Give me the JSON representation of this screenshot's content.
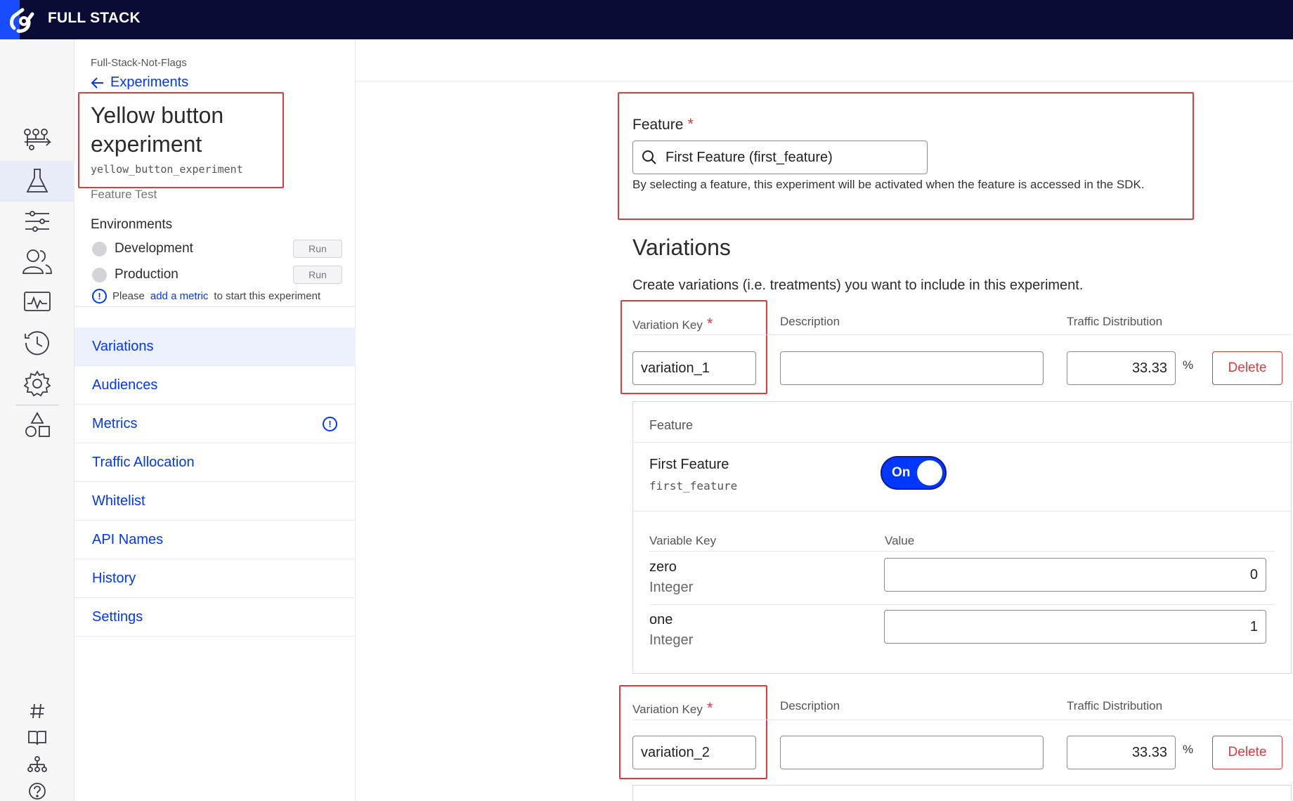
{
  "app": {
    "brand": "FULL STACK"
  },
  "breadcrumb": {
    "project": "Full-Stack-Not-Flags",
    "back_label": "Experiments"
  },
  "experiment": {
    "title": "Yellow button experiment",
    "key": "yellow_button_experiment",
    "type": "Feature Test"
  },
  "environments": {
    "heading": "Environments",
    "items": [
      {
        "name": "Development",
        "action": "Run"
      },
      {
        "name": "Production",
        "action": "Run"
      }
    ],
    "note_prefix": "Please",
    "note_link": "add a metric",
    "note_suffix": "to start this experiment"
  },
  "nav": {
    "items": [
      {
        "label": "Variations",
        "active": true
      },
      {
        "label": "Audiences"
      },
      {
        "label": "Metrics",
        "warning": true
      },
      {
        "label": "Traffic Allocation"
      },
      {
        "label": "Whitelist"
      },
      {
        "label": "API Names"
      },
      {
        "label": "History"
      },
      {
        "label": "Settings"
      }
    ]
  },
  "feature_select": {
    "label": "Feature",
    "required_mark": "*",
    "value": "First Feature (first_feature)",
    "help": "By selecting a feature, this experiment will be activated when the feature is accessed in the SDK."
  },
  "variations": {
    "title": "Variations",
    "subtitle": "Create variations (i.e. treatments) you want to include in this experiment.",
    "columns": {
      "key": "Variation Key",
      "description": "Description",
      "traffic": "Traffic Distribution"
    },
    "required_mark": "*",
    "percent_sign": "%",
    "delete_label": "Delete",
    "items": [
      {
        "key": "variation_1",
        "description": "",
        "traffic": "33.33",
        "feature": {
          "heading": "Feature",
          "name": "First Feature",
          "key": "first_feature",
          "toggle_label": "On",
          "variable_columns": {
            "key": "Variable Key",
            "value": "Value"
          },
          "variables": [
            {
              "key": "zero",
              "type": "Integer",
              "value": "0"
            },
            {
              "key": "one",
              "type": "Integer",
              "value": "1"
            }
          ]
        }
      },
      {
        "key": "variation_2",
        "description": "",
        "traffic": "33.33"
      }
    ]
  },
  "colors": {
    "accent": "#0037ff",
    "topbar": "#0b0c35",
    "danger": "#e0393e",
    "logo": "#1a4cff"
  },
  "icons": {
    "rail": [
      "flags-icon",
      "experiments-icon",
      "settings-sliders-icon",
      "audiences-icon",
      "monitor-icon",
      "history-icon",
      "gear-icon",
      "shapes-icon"
    ],
    "rail_bottom": [
      "hashtag-icon",
      "book-icon",
      "org-chart-icon",
      "help-icon"
    ]
  }
}
